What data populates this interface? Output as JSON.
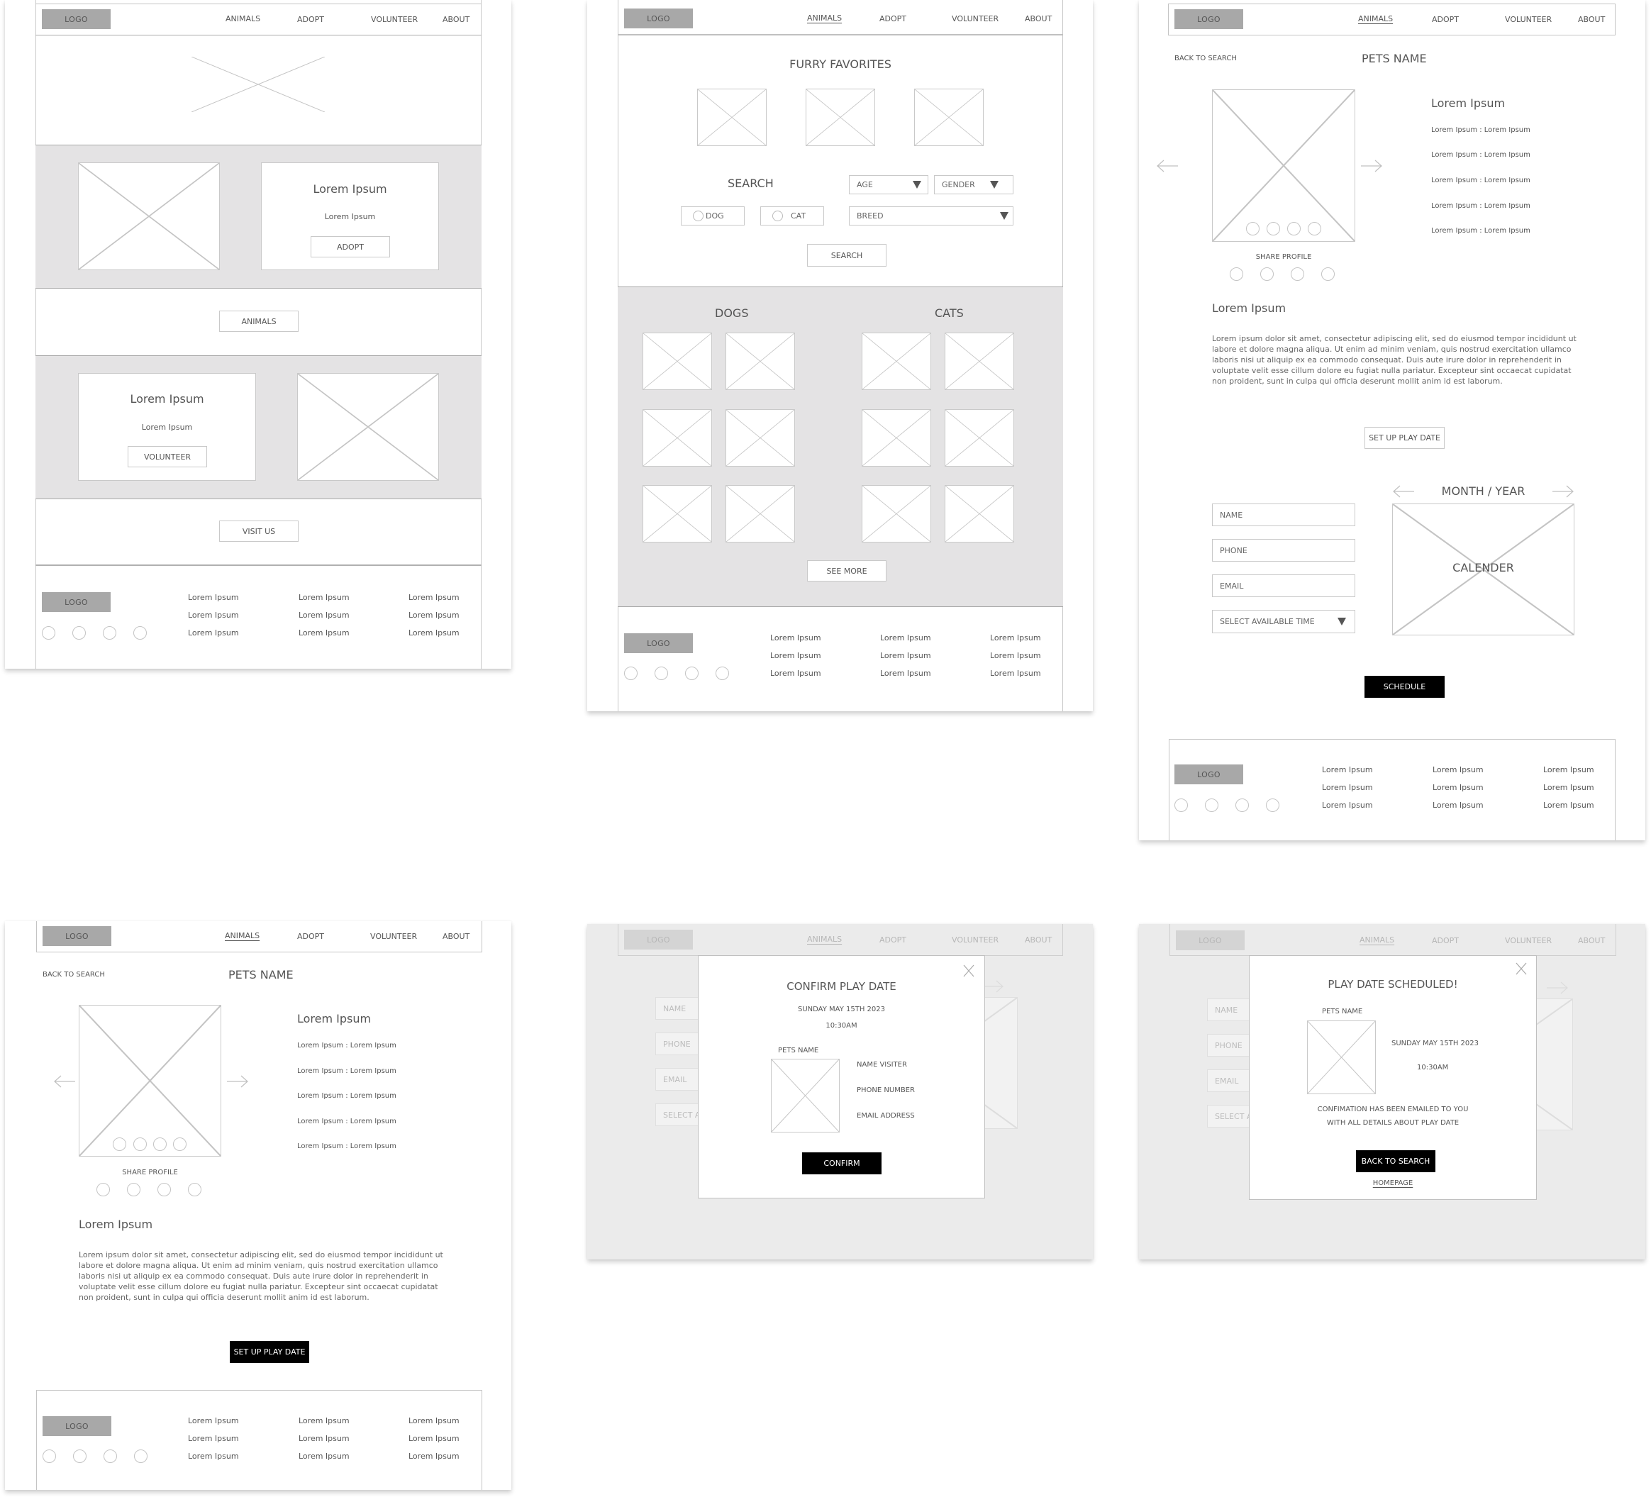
{
  "nav": {
    "logo": "LOGO",
    "links": [
      "ANIMALS",
      "ADOPT",
      "VOLUNTEER",
      "ABOUT"
    ]
  },
  "footer": {
    "logo": "LOGO",
    "columns": [
      [
        "Lorem Ipsum",
        "Lorem Ipsum",
        "Lorem Ipsum"
      ],
      [
        "Lorem Ipsum",
        "Lorem Ipsum",
        "Lorem Ipsum"
      ],
      [
        "Lorem Ipsum",
        "Lorem Ipsum",
        "Lorem Ipsum"
      ]
    ]
  },
  "home": {
    "adopt_card": {
      "title": "Lorem Ipsum",
      "subtitle": "Lorem Ipsum",
      "button": "ADOPT"
    },
    "animals_button": "ANIMALS",
    "volunteer_card": {
      "title": "Lorem Ipsum",
      "subtitle": "Lorem Ipsum",
      "button": "VOLUNTEER"
    },
    "visit_button": "VISIT US"
  },
  "animals": {
    "favorites_title": "FURRY FAVORITES",
    "search_title": "SEARCH",
    "filters": {
      "age": "AGE",
      "gender": "GENDER",
      "breed": "BREED",
      "dog": "DOG",
      "cat": "CAT"
    },
    "search_button": "SEARCH",
    "dogs_title": "DOGS",
    "cats_title": "CATS",
    "see_more_button": "SEE MORE"
  },
  "pet_profile": {
    "back_link": "BACK TO SEARCH",
    "pet_name": "PETS NAME",
    "details_title": "Lorem Ipsum",
    "details": [
      "Lorem Ipsum : Lorem Ipsum",
      "Lorem Ipsum : Lorem Ipsum",
      "Lorem Ipsum : Lorem Ipsum",
      "Lorem Ipsum : Lorem Ipsum",
      "Lorem Ipsum : Lorem Ipsum"
    ],
    "share_label": "SHARE PROFILE",
    "about_title": "Lorem Ipsum",
    "about_text": "Lorem ipsum dolor sit amet, consectetur adipiscing elit, sed do eiusmod tempor incididunt ut labore et dolore magna aliqua. Ut enim ad minim veniam, quis nostrud exercitation ullamco laboris nisi ut aliquip ex ea commodo consequat. Duis aute irure dolor in reprehenderit in voluptate velit esse cillum dolore eu fugiat nulla pariatur. Excepteur sint occaecat cupidatat non proident, sunt in culpa qui officia deserunt mollit anim id est laborum.",
    "setup_button": "SET UP PLAY DATE"
  },
  "schedule": {
    "name_placeholder": "NAME",
    "phone_placeholder": "PHONE",
    "email_placeholder": "EMAIL",
    "time_select": "SELECT AVAILABLE TIME",
    "calendar_header": "MONTH / YEAR",
    "calendar_label": "CALENDER",
    "schedule_button": "SCHEDULE"
  },
  "confirm_modal": {
    "title": "CONFIRM PLAY DATE",
    "date": "SUNDAY MAY 15TH 2023",
    "time": "10:30AM",
    "pet_name": "PETS NAME",
    "visitor_name": "NAME VISITER",
    "phone": "PHONE NUMBER",
    "email": "EMAIL ADDRESS",
    "confirm_button": "CONFIRM",
    "bg_fields": [
      "NAME",
      "PHONE",
      "EMAIL",
      "SELECT AV"
    ]
  },
  "scheduled_modal": {
    "title": "PLAY DATE SCHEDULED!",
    "pet_name": "PETS NAME",
    "date": "SUNDAY MAY 15TH 2023",
    "time": "10:30AM",
    "message_line1": "CONFIMATION HAS BEEN EMAILED TO YOU",
    "message_line2": "WITH ALL DETAILS ABOUT PLAY DATE",
    "back_button": "BACK TO SEARCH",
    "homepage_link": "HOMEPAGE",
    "bg_fields": [
      "NAME",
      "PHONE",
      "EMAIL",
      "SELECT AV"
    ]
  }
}
